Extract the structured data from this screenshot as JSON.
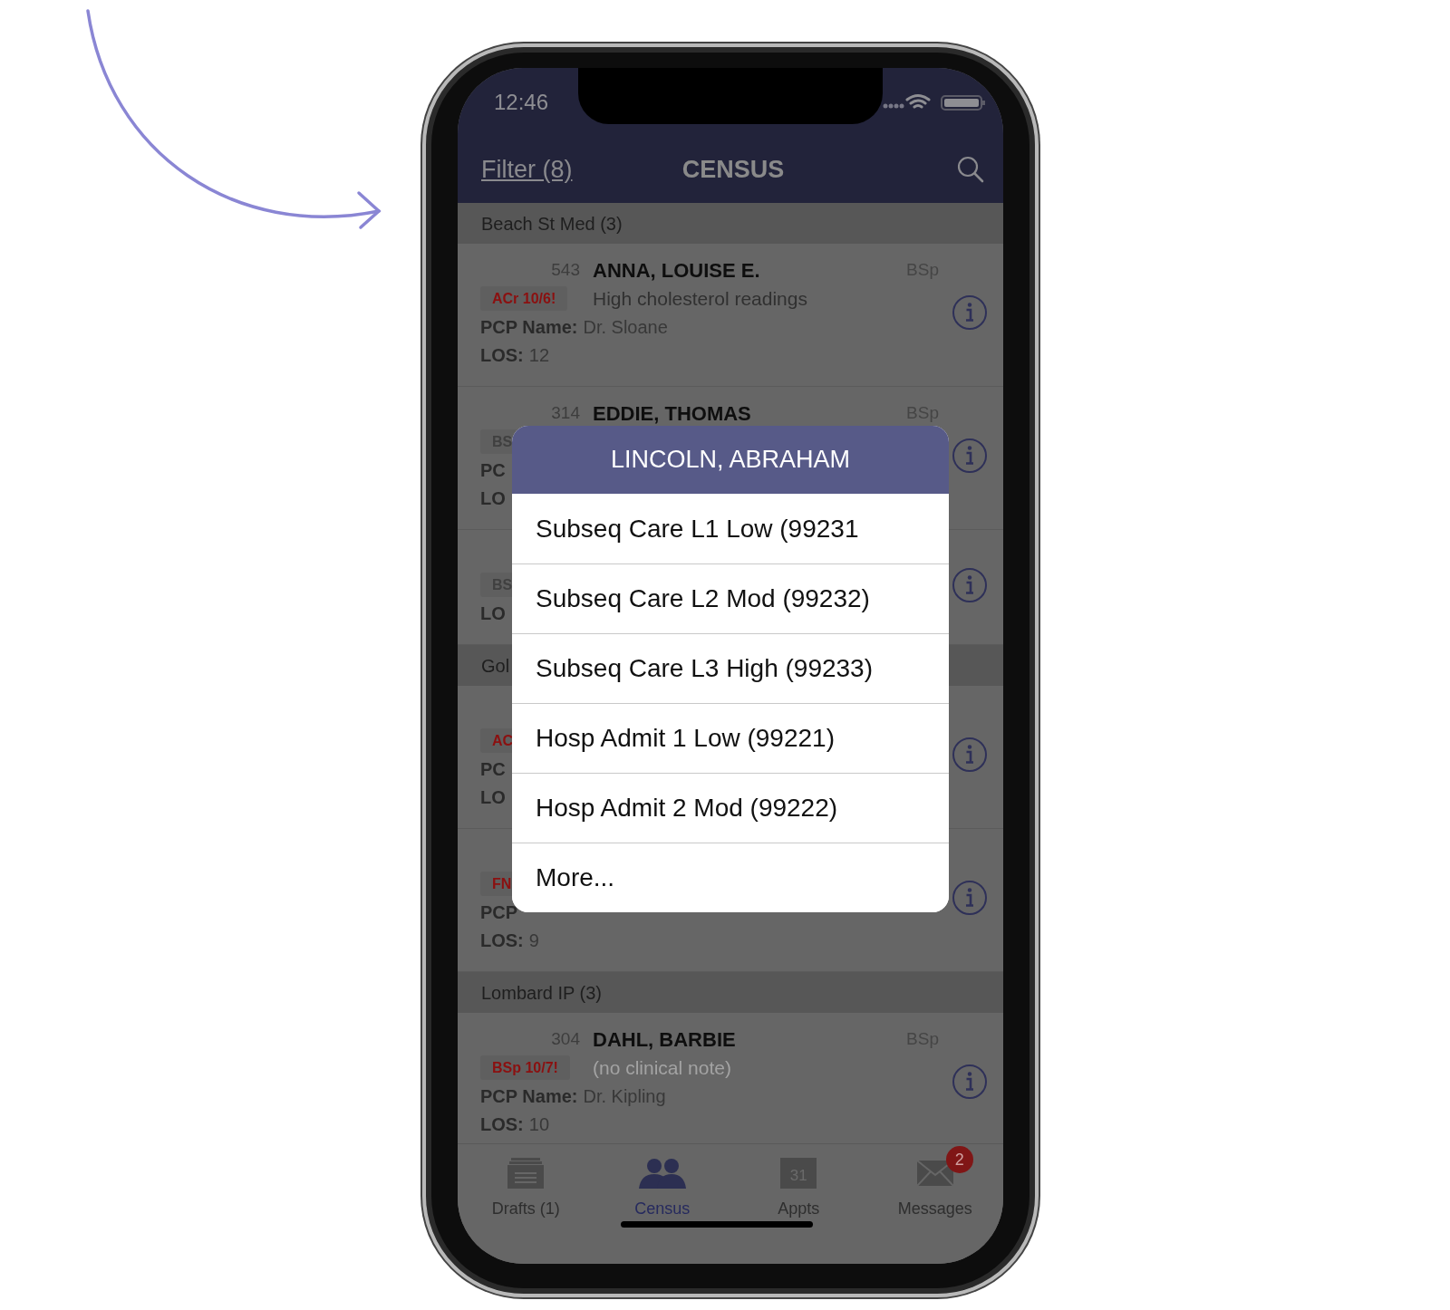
{
  "status_bar": {
    "time": "12:46"
  },
  "nav": {
    "filter": "Filter (8)",
    "title": "CENSUS"
  },
  "list": [
    {
      "kind": "header",
      "label": "Beach St Med (3)"
    },
    {
      "kind": "patient",
      "room": "543",
      "name": "ANNA, LOUISE E.",
      "tag": "BSp",
      "badge": "ACr 10/6!",
      "badge_alert": true,
      "note": "High cholesterol readings",
      "note_muted": false,
      "pcp_label": "PCP Name:",
      "pcp": "Dr. Sloane",
      "los_label": "LOS:",
      "los": "12"
    },
    {
      "kind": "patient",
      "room": "314",
      "name": "EDDIE, THOMAS",
      "tag": "BSp",
      "badge": "BS",
      "badge_alert": false,
      "pcp_label": "PC",
      "los_label": "LO"
    },
    {
      "kind": "patient",
      "badge": "BS",
      "badge_alert": false,
      "los_label": "LO"
    },
    {
      "kind": "header",
      "label": "Gol"
    },
    {
      "kind": "patient",
      "badge": "AC",
      "badge_alert": true,
      "pcp_label": "PC",
      "los_label": "LO"
    },
    {
      "kind": "patient",
      "badge": "FN",
      "badge_alert": true,
      "pcp_label": "PCP",
      "los_label": "LOS:",
      "los": "9"
    },
    {
      "kind": "header",
      "label": "Lombard IP (3)"
    },
    {
      "kind": "patient",
      "room": "304",
      "name": "DAHL, BARBIE",
      "tag": "BSp",
      "badge": "BSp 10/7!",
      "badge_alert": true,
      "note": "(no clinical note)",
      "note_muted": true,
      "pcp_label": "PCP Name:",
      "pcp": "Dr. Kipling",
      "los_label": "LOS:",
      "los": "10"
    }
  ],
  "popup": {
    "title": "LINCOLN, ABRAHAM",
    "options": [
      "Subseq Care L1 Low (99231",
      "Subseq Care L2 Mod (99232)",
      "Subseq Care L3 High (99233)",
      "Hosp Admit 1 Low (99221)",
      "Hosp Admit 2 Mod (99222)",
      "More..."
    ]
  },
  "tabs": [
    {
      "kind": "drafts",
      "label": "Drafts (1)",
      "selected": false
    },
    {
      "kind": "census",
      "label": "Census",
      "selected": true
    },
    {
      "kind": "calendar",
      "label": "Appts",
      "selected": false,
      "icon_text": "31"
    },
    {
      "kind": "messages",
      "label": "Messages",
      "selected": false,
      "count": "2"
    }
  ]
}
